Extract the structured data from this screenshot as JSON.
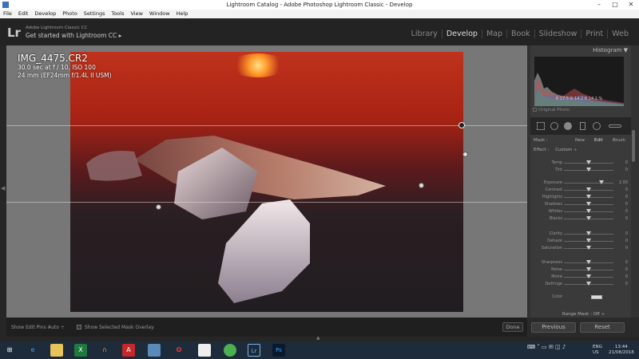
{
  "window": {
    "title": "Lightroom Catalog - Adobe Photoshop Lightroom Classic - Develop",
    "controls": [
      "–",
      "□",
      "✕"
    ]
  },
  "menubar": [
    "File",
    "Edit",
    "Develop",
    "Photo",
    "Settings",
    "Tools",
    "View",
    "Window",
    "Help"
  ],
  "identity_plate": {
    "logo": "Lr",
    "subtitle": "Adobe Lightroom Classic CC",
    "cta": "Get started with Lightroom CC ▸"
  },
  "modules": [
    {
      "label": "Library",
      "active": false
    },
    {
      "label": "Develop",
      "active": true
    },
    {
      "label": "Map",
      "active": false
    },
    {
      "label": "Book",
      "active": false
    },
    {
      "label": "Slideshow",
      "active": false
    },
    {
      "label": "Print",
      "active": false
    },
    {
      "label": "Web",
      "active": false
    }
  ],
  "photo_info": {
    "filename": "IMG_4475.CR2",
    "exposure": "30.0 sec at f / 10, ISO 100",
    "lens": "24 mm (EF24mm f/1.4L II USM)"
  },
  "toolbar": {
    "show_edit_pins_label": "Show Edit Pins :",
    "show_edit_pins_value": "Auto ÷",
    "overlay_label": "Show Selected Mask Overlay",
    "done": "Done"
  },
  "histogram": {
    "title": "Histogram ▼",
    "readout": "R   17.5   G   14.2   B   14.1  %",
    "original_photo": "Original Photo"
  },
  "mask": {
    "label": "Mask :",
    "new": "New",
    "edit": "Edit",
    "brush": "Brush"
  },
  "effect": {
    "label": "Effect :",
    "value": "Custom ÷"
  },
  "sliders": [
    {
      "label": "Temp",
      "value": "0",
      "pos": 0.5
    },
    {
      "label": "Tint",
      "value": "0",
      "pos": 0.5
    },
    {
      "label": "Exposure",
      "value": "2.00",
      "pos": 0.75
    },
    {
      "label": "Contrast",
      "value": "0",
      "pos": 0.5
    },
    {
      "label": "Highlights",
      "value": "0",
      "pos": 0.5
    },
    {
      "label": "Shadows",
      "value": "0",
      "pos": 0.5
    },
    {
      "label": "Whites",
      "value": "0",
      "pos": 0.5
    },
    {
      "label": "Blacks",
      "value": "0",
      "pos": 0.5
    },
    {
      "label": "Clarity",
      "value": "0",
      "pos": 0.5
    },
    {
      "label": "Dehaze",
      "value": "0",
      "pos": 0.5
    },
    {
      "label": "Saturation",
      "value": "0",
      "pos": 0.5
    },
    {
      "label": "Sharpness",
      "value": "0",
      "pos": 0.5
    },
    {
      "label": "Noise",
      "value": "0",
      "pos": 0.5
    },
    {
      "label": "Moiré",
      "value": "0",
      "pos": 0.5
    },
    {
      "label": "Defringe",
      "value": "0",
      "pos": 0.5
    }
  ],
  "color_label": "Color",
  "range_mask": "Range Mask : Off ÷",
  "buttons": {
    "previous": "Previous",
    "reset": "Reset"
  },
  "taskbar": {
    "apps": [
      "start",
      "ie",
      "explorer",
      "excel",
      "headphones",
      "acrobat",
      "display",
      "opera",
      "notepad",
      "chrome",
      "lightroom",
      "photoshop"
    ],
    "lang": "ENG",
    "region": "US",
    "time": "13:44",
    "date": "21/08/2018"
  }
}
